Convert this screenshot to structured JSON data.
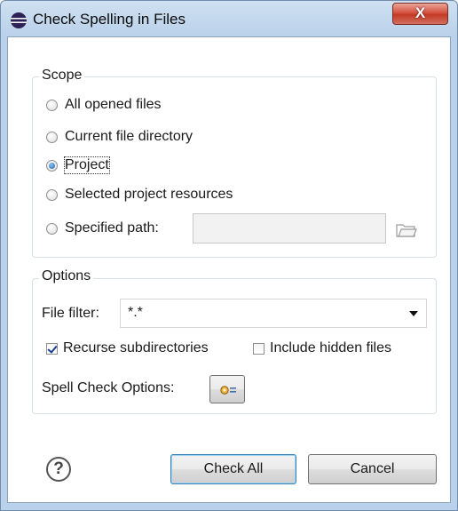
{
  "window": {
    "title": "Check Spelling in Files",
    "close_label": "X",
    "icon": "eclipse-icon"
  },
  "scope": {
    "legend": "Scope",
    "options": [
      {
        "label": "All opened files",
        "checked": false
      },
      {
        "label": "Current file directory",
        "checked": false
      },
      {
        "label": "Project",
        "checked": true
      },
      {
        "label": "Selected project resources",
        "checked": false
      },
      {
        "label": "Specified path:",
        "checked": false
      }
    ],
    "path_value": "",
    "browse_icon": "folder-icon"
  },
  "options": {
    "legend": "Options",
    "file_filter_label": "File filter:",
    "file_filter_value": "*.*",
    "recurse_label": "Recurse subdirectories",
    "recurse_checked": true,
    "hidden_label": "Include hidden files",
    "hidden_checked": false,
    "spell_check_label": "Spell Check Options:",
    "spell_check_icon": "gear-list-icon"
  },
  "footer": {
    "help_icon_text": "?",
    "check_all_label": "Check All",
    "cancel_label": "Cancel"
  }
}
